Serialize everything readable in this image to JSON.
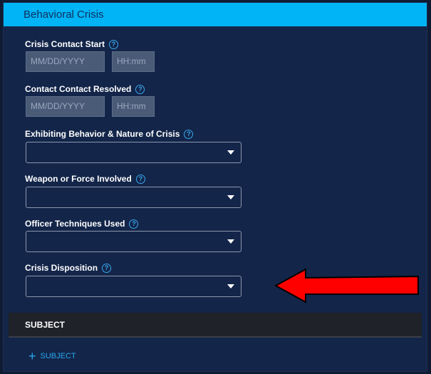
{
  "header": {
    "title": "Behavioral Crisis"
  },
  "fields": {
    "contact_start": {
      "label": "Crisis Contact Start",
      "date_placeholder": "MM/DD/YYYY",
      "time_placeholder": "HH:mm"
    },
    "contact_resolved": {
      "label": "Contact Contact Resolved",
      "date_placeholder": "MM/DD/YYYY",
      "time_placeholder": "HH:mm"
    },
    "behavior": {
      "label": "Exhibiting Behavior & Nature of Crisis",
      "value": ""
    },
    "weapon": {
      "label": "Weapon or Force Involved",
      "value": ""
    },
    "techniques": {
      "label": "Officer Techniques Used",
      "value": ""
    },
    "disposition": {
      "label": "Crisis Disposition",
      "value": ""
    }
  },
  "subject_section": {
    "title": "SUBJECT",
    "add_label": "SUBJECT"
  },
  "icons": {
    "help": "?",
    "plus": "+"
  },
  "colors": {
    "header": "#00b4f5",
    "panel": "#132549",
    "accent": "#28a8ef",
    "arrow": "#ff0000"
  }
}
